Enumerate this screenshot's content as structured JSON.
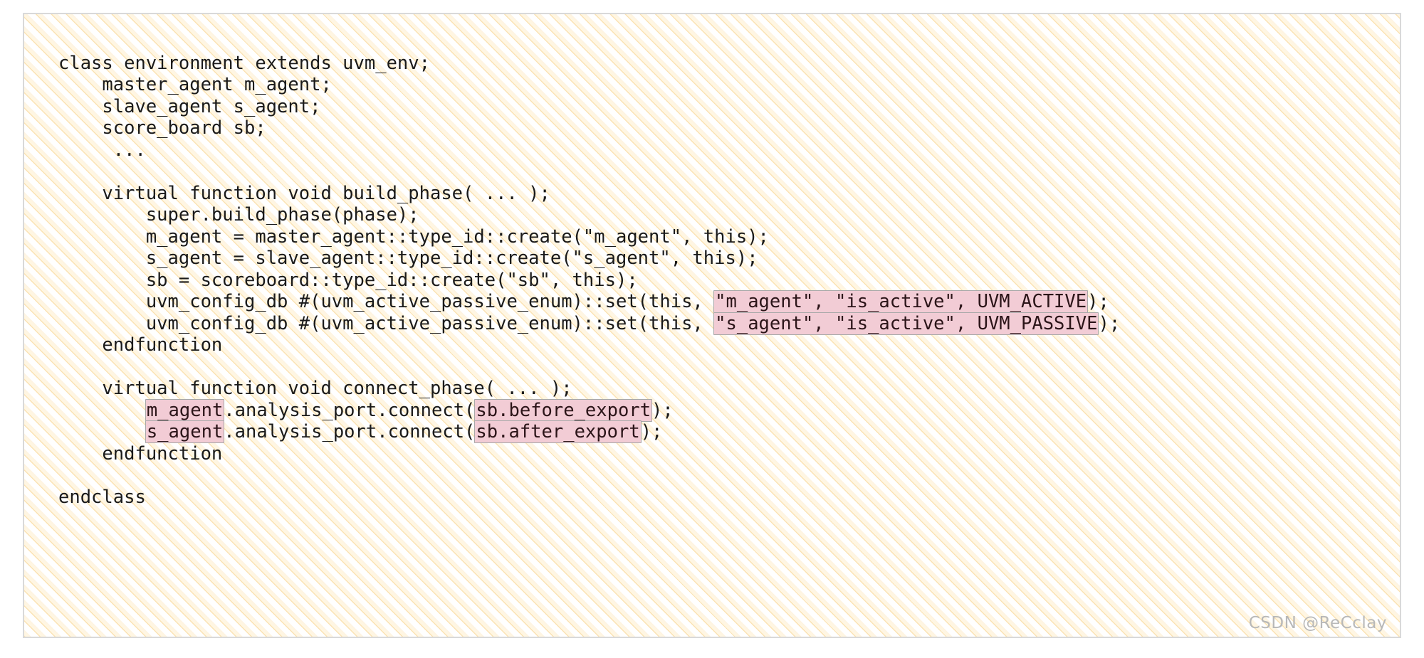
{
  "card": {
    "border_color": "#d9d9d9",
    "stripe_color": "#f7cb76",
    "background_color": "#ffffff"
  },
  "highlight": {
    "background_color": "#f2ccd5",
    "border_color": "#a8a8a8",
    "text_color": "#2b1418"
  },
  "code": {
    "language": "SystemVerilog/UVM",
    "text_color": "#1a1a1a",
    "lines": [
      {
        "id": "l01",
        "plain": "class environment extends uvm_env;"
      },
      {
        "id": "l02",
        "plain": "    master_agent m_agent;"
      },
      {
        "id": "l03",
        "plain": "    slave_agent s_agent;"
      },
      {
        "id": "l04",
        "plain": "    score_board sb;"
      },
      {
        "id": "l05",
        "plain": "     ..."
      },
      {
        "id": "l06",
        "plain": ""
      },
      {
        "id": "l07",
        "plain": "    virtual function void build_phase( ... );"
      },
      {
        "id": "l08",
        "plain": "        super.build_phase(phase);"
      },
      {
        "id": "l09",
        "plain": "        m_agent = master_agent::type_id::create(\"m_agent\", this);"
      },
      {
        "id": "l10",
        "plain": "        s_agent = slave_agent::type_id::create(\"s_agent\", this);"
      },
      {
        "id": "l11",
        "plain": "        sb = scoreboard::type_id::create(\"sb\", this);"
      },
      {
        "id": "l12",
        "pre": "        uvm_config_db #(uvm_active_passive_enum)::set(this, ",
        "hl": "\"m_agent\", \"is_active\", UVM_ACTIVE",
        "post": ");"
      },
      {
        "id": "l13",
        "pre": "        uvm_config_db #(uvm_active_passive_enum)::set(this, ",
        "hl": "\"s_agent\", \"is_active\", UVM_PASSIVE",
        "post": ");"
      },
      {
        "id": "l14",
        "plain": "    endfunction"
      },
      {
        "id": "l15",
        "plain": ""
      },
      {
        "id": "l16",
        "plain": "    virtual function void connect_phase( ... );"
      },
      {
        "id": "l17",
        "pre": "        ",
        "hl": "m_agent",
        "mid": ".analysis_port.connect(",
        "hl2": "sb.before_export",
        "post": ");"
      },
      {
        "id": "l18",
        "pre": "        ",
        "hl": "s_agent",
        "mid": ".analysis_port.connect(",
        "hl2": "sb.after_export",
        "post": ");"
      },
      {
        "id": "l19",
        "plain": "    endfunction"
      },
      {
        "id": "l20",
        "plain": ""
      },
      {
        "id": "l21",
        "plain": "endclass"
      }
    ]
  },
  "watermark": {
    "text": "CSDN @ReCclay",
    "color": "#b8b8b8"
  }
}
